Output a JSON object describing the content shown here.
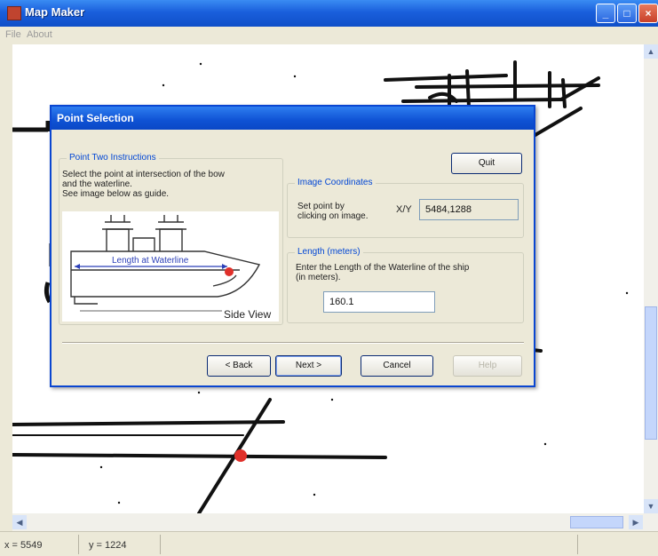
{
  "window": {
    "title": "Map Maker"
  },
  "menu": {
    "items": [
      "File",
      "About"
    ]
  },
  "dialog": {
    "title": "Point Selection",
    "instructions_group": {
      "title": "Point Two Instructions",
      "lines": [
        "Select the point at intersection of the bow",
        "and the waterline.",
        "See image below as guide."
      ],
      "guide_label": "Length at Waterline",
      "side_view_label": "Side View"
    },
    "quit_label": "Quit",
    "coords_group": {
      "title": "Image Coordinates",
      "prompt_lines": [
        "Set point by",
        "clicking on image."
      ],
      "xy_label": "X/Y",
      "xy_value": "5484,1288"
    },
    "length_group": {
      "title": "Length (meters)",
      "prompt_lines": [
        "Enter the Length of the Waterline of the ship",
        "(in meters)."
      ],
      "value": "160.1"
    },
    "buttons": {
      "back": "< Back",
      "next": "Next >",
      "cancel": "Cancel",
      "help": "Help"
    }
  },
  "status": {
    "x": "x = 5549",
    "y": "y = 1224"
  },
  "colors": {
    "titlebar": "#1a5fdc",
    "dialog_border": "#0a46d1",
    "group_title": "#0046d5",
    "marker": "#e0302a"
  }
}
